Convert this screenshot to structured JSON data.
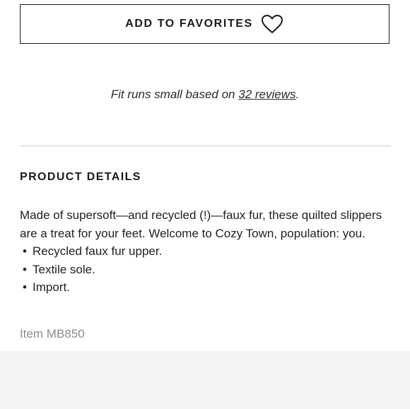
{
  "favorites_button": {
    "label": "ADD TO FAVORITES",
    "icon": "heart-outline-icon"
  },
  "fit_note": {
    "prefix": "Fit runs small based on ",
    "link_text": "32 reviews",
    "suffix": "."
  },
  "product_details": {
    "heading": "PRODUCT DETAILS",
    "description": "Made of supersoft—and recycled (!)—faux fur, these quilted slippers are a treat for your feet. Welcome to Cozy Town, population: you.",
    "bullets": [
      "Recycled faux fur upper.",
      "Textile sole.",
      "Import."
    ],
    "item_code": "Item MB850"
  },
  "colors": {
    "text": "#1a1a1a",
    "muted": "#8c8c8c",
    "divider": "#cfcfcf",
    "footer_band": "#f3f3f3"
  }
}
